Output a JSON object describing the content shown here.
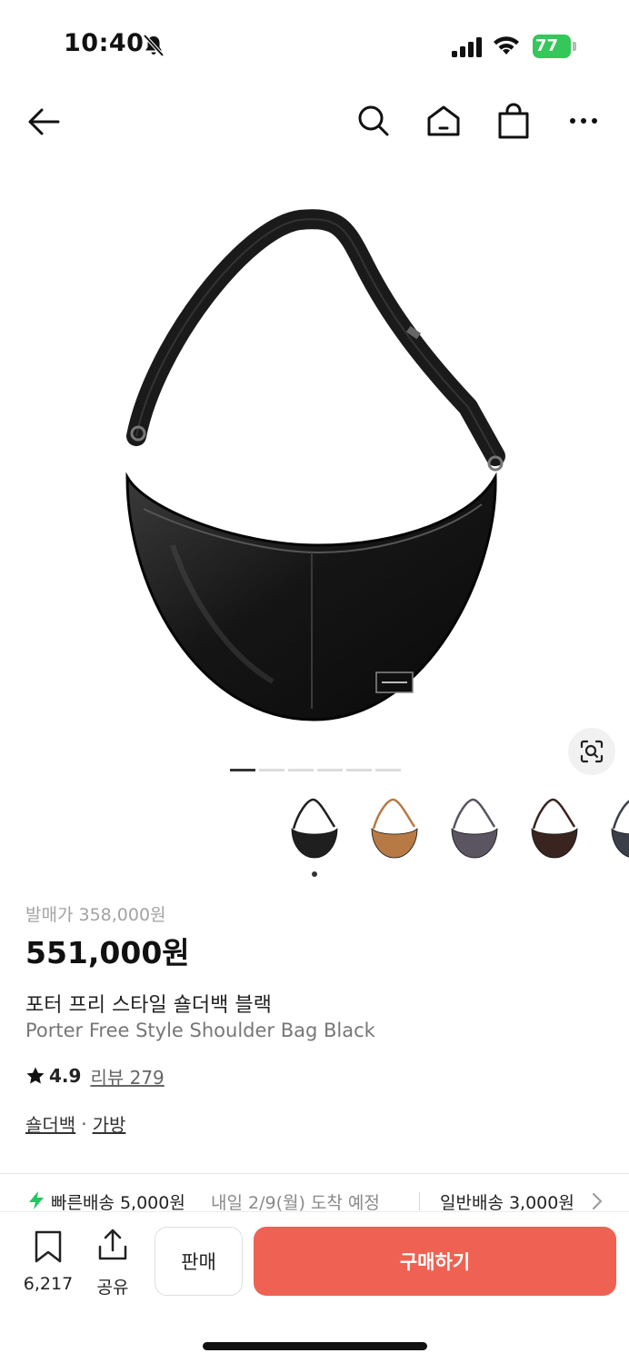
{
  "status_bar": {
    "time": "10:40",
    "battery_level": "77",
    "battery_color": "#35c759"
  },
  "nav": {
    "icons": [
      "back-arrow-icon",
      "search-icon",
      "home-icon",
      "shopping-bag-icon",
      "more-icon"
    ]
  },
  "gallery": {
    "image_count": 6,
    "active_index": 0,
    "thumbnails": [
      {
        "name": "black",
        "color": "#1f1f1f"
      },
      {
        "name": "tan",
        "color": "#b87a44"
      },
      {
        "name": "gray",
        "color": "#5a5560"
      },
      {
        "name": "brown",
        "color": "#3a2420"
      },
      {
        "name": "navy",
        "color": "#3b3f4a"
      }
    ]
  },
  "product": {
    "release_price": "발매가 358,000원",
    "price": "551,000원",
    "name_ko": "포터 프리 스타일 숄더백 블랙",
    "name_en": "Porter Free Style Shoulder Bag Black",
    "rating": "4.9",
    "review_label": "리뷰 279",
    "categories": [
      "숄더백",
      "가방"
    ],
    "category_separator": "·"
  },
  "delivery": {
    "fast_label": "빠른배송 5,000원",
    "fast_note": "내일 2/9(월) 도착 예정",
    "normal_label": "일반배송 3,000원",
    "accent_color": "#22c55e"
  },
  "bottom_bar": {
    "save_count": "6,217",
    "share_label": "공유",
    "sell_label": "판매",
    "buy_label": "구매하기",
    "buy_color": "#ef6253"
  }
}
